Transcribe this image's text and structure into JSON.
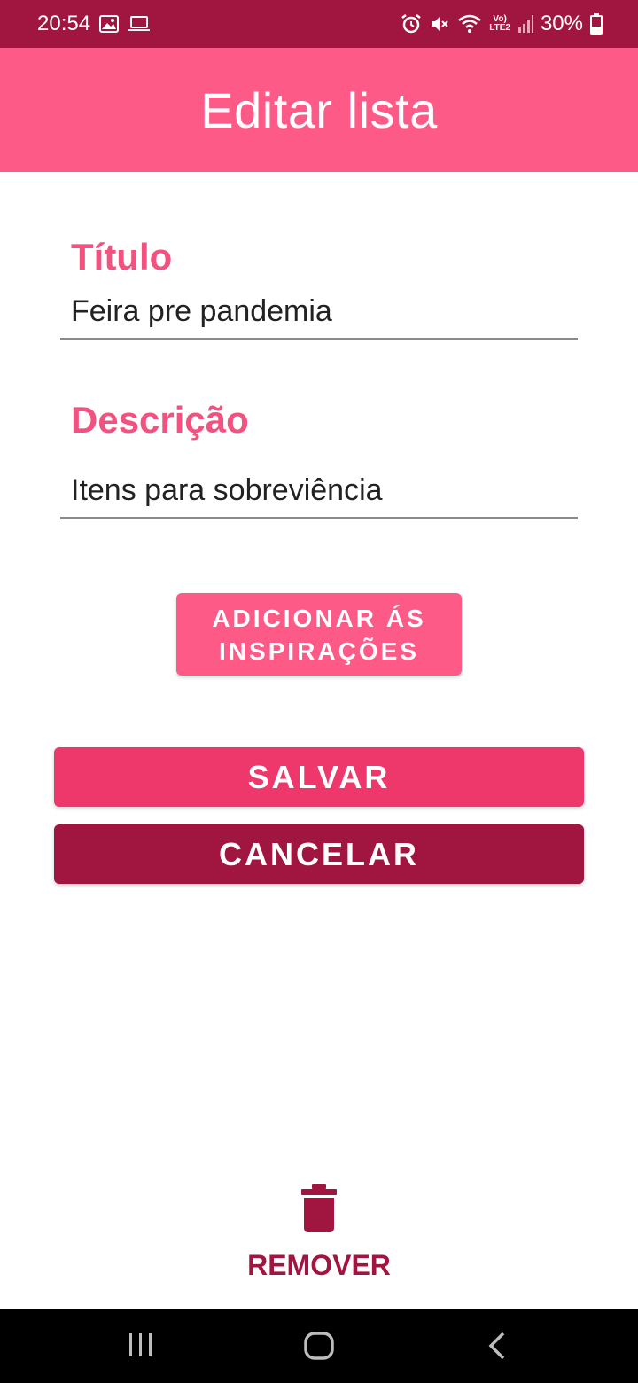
{
  "status_bar": {
    "time": "20:54",
    "battery": "30%",
    "network_badge_top": "Vo)",
    "network_badge_bottom": "LTE2"
  },
  "app_bar": {
    "title": "Editar lista"
  },
  "form": {
    "title_label": "Título",
    "title_value": "Feira pre pandemia",
    "description_label": "Descrição",
    "description_value": "Itens para sobreviência"
  },
  "buttons": {
    "add_inspirations_line1": "ADICIONAR ÁS",
    "add_inspirations_line2": "INSPIRAÇÕES",
    "save": "SALVAR",
    "cancel": "CANCELAR",
    "remove": "REMOVER"
  },
  "colors": {
    "status_bar": "#a01640",
    "app_bar": "#fd5a87",
    "label": "#f2527f",
    "save": "#ee376a",
    "cancel": "#a01640"
  }
}
